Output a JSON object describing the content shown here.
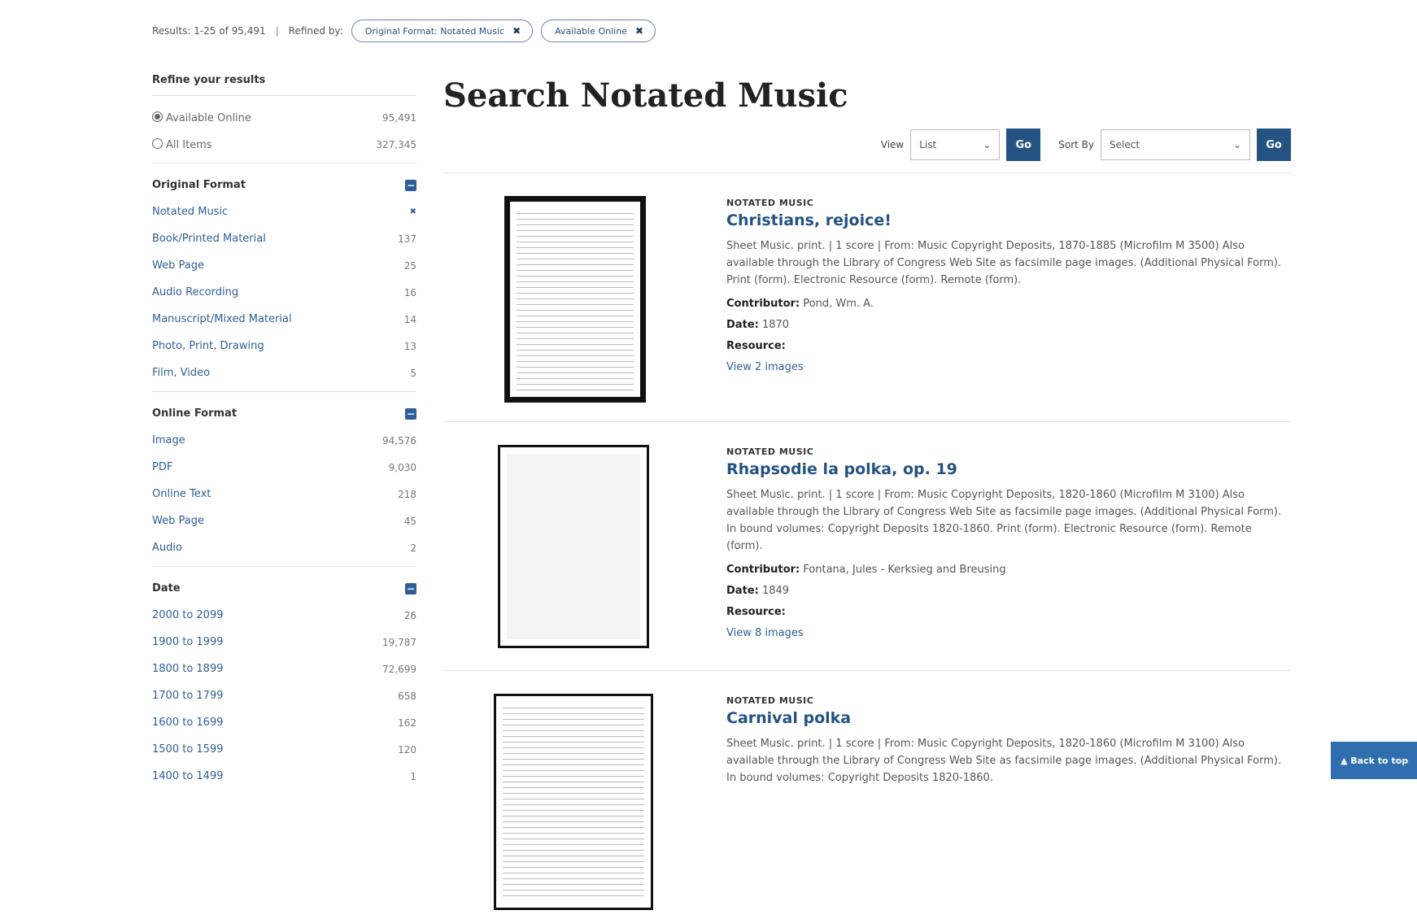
{
  "topbar": {
    "results_text": "Results: 1-25 of 95,491",
    "refined_by": "Refined by:",
    "filters": [
      {
        "label": "Original Format: Notated Music"
      },
      {
        "label": "Available Online"
      }
    ]
  },
  "sidebar": {
    "heading": "Refine your results",
    "availability": [
      {
        "label": "Available Online",
        "count": "95,491",
        "selected": true
      },
      {
        "label": "All Items",
        "count": "327,345",
        "selected": false
      }
    ],
    "groups": [
      {
        "title": "Original Format",
        "items": [
          {
            "label": "Notated Music",
            "count": "✖"
          },
          {
            "label": "Book/Printed Material",
            "count": "137"
          },
          {
            "label": "Web Page",
            "count": "25"
          },
          {
            "label": "Audio Recording",
            "count": "16"
          },
          {
            "label": "Manuscript/Mixed Material",
            "count": "14"
          },
          {
            "label": "Photo, Print, Drawing",
            "count": "13"
          },
          {
            "label": "Film, Video",
            "count": "5"
          }
        ]
      },
      {
        "title": "Online Format",
        "items": [
          {
            "label": "Image",
            "count": "94,576"
          },
          {
            "label": "PDF",
            "count": "9,030"
          },
          {
            "label": "Online Text",
            "count": "218"
          },
          {
            "label": "Web Page",
            "count": "45"
          },
          {
            "label": "Audio",
            "count": "2"
          }
        ]
      },
      {
        "title": "Date",
        "items": [
          {
            "label": "2000 to 2099",
            "count": "26"
          },
          {
            "label": "1900 to 1999",
            "count": "19,787"
          },
          {
            "label": "1800 to 1899",
            "count": "72,699"
          },
          {
            "label": "1700 to 1799",
            "count": "658"
          },
          {
            "label": "1600 to 1699",
            "count": "162"
          },
          {
            "label": "1500 to 1599",
            "count": "120"
          },
          {
            "label": "1400 to 1499",
            "count": "1"
          }
        ]
      }
    ]
  },
  "main": {
    "title": "Search Notated Music",
    "view_label": "View",
    "view_value": "List",
    "sort_label": "Sort By",
    "sort_value": "Select",
    "go_label": "Go",
    "results": [
      {
        "kind": "NOTATED MUSIC",
        "title": "Christians, rejoice!",
        "desc": "Sheet Music. print. | 1 score | From: Music Copyright Deposits, 1870-1885 (Microfilm M 3500) Also available through the Library of Congress Web Site as facsimile page images. (Additional Physical Form). Print (form). Electronic Resource (form). Remote (form).",
        "contributor_label": "Contributor:",
        "contributor": "Pond, Wm. A.",
        "date_label": "Date:",
        "date": "1870",
        "resource_label": "Resource:",
        "resource": "View 2 images"
      },
      {
        "kind": "NOTATED MUSIC",
        "title": "Rhapsodie la polka, op. 19",
        "desc": "Sheet Music. print. | 1 score | From: Music Copyright Deposits, 1820-1860 (Microfilm M 3100) Also available through the Library of Congress Web Site as facsimile page images. (Additional Physical Form). In bound volumes: Copyright Deposits 1820-1860. Print (form). Electronic Resource (form). Remote (form).",
        "contributor_label": "Contributor:",
        "contributor": "Fontana, Jules - Kerksieg and Breusing",
        "date_label": "Date:",
        "date": "1849",
        "resource_label": "Resource:",
        "resource": "View 8 images"
      },
      {
        "kind": "NOTATED MUSIC",
        "title": "Carnival polka",
        "desc": "Sheet Music. print. | 1 score | From: Music Copyright Deposits, 1820-1860 (Microfilm M 3100) Also available through the Library of Congress Web Site as facsimile page images. (Additional Physical Form). In bound volumes: Copyright Deposits 1820-1860.",
        "contributor_label": "",
        "contributor": "",
        "date_label": "",
        "date": "",
        "resource_label": "",
        "resource": ""
      }
    ]
  },
  "back_to_top": "▲ Back to top"
}
